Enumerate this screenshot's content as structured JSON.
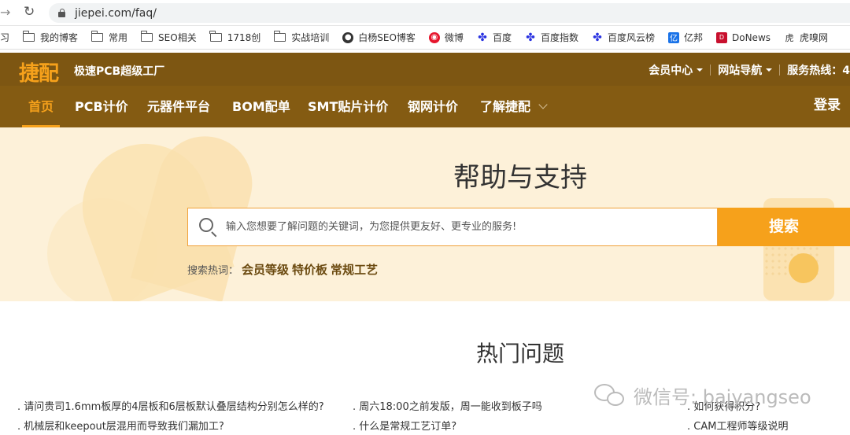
{
  "browser": {
    "url": "jiepei.com/faq/",
    "bookmarks": [
      {
        "label": "学习",
        "icon": "none"
      },
      {
        "label": "我的博客",
        "icon": "folder-icon"
      },
      {
        "label": "常用",
        "icon": "folder-icon"
      },
      {
        "label": "SEO相关",
        "icon": "folder-icon"
      },
      {
        "label": "1718创",
        "icon": "folder-icon"
      },
      {
        "label": "实战培训",
        "icon": "folder-icon"
      },
      {
        "label": "白杨SEO博客",
        "icon": "globe-icon"
      },
      {
        "label": "微博",
        "icon": "weibo-icon"
      },
      {
        "label": "百度",
        "icon": "baidu-paw-icon"
      },
      {
        "label": "百度指数",
        "icon": "baidu-paw-icon"
      },
      {
        "label": "百度风云榜",
        "icon": "baidu-paw-icon"
      },
      {
        "label": "亿邦",
        "icon": "yibang-icon"
      },
      {
        "label": "DoNews",
        "icon": "donews-icon"
      },
      {
        "label": "虎嗅网",
        "icon": "huxiu-icon"
      }
    ]
  },
  "header": {
    "logo": "捷配",
    "slogan": "极速PCB超级工厂",
    "member_center": "会员中心",
    "site_nav": "网站导航",
    "hotline": "服务热线：4"
  },
  "nav": {
    "items": [
      "首页",
      "PCB计价",
      "元器件平台",
      "BOM配单",
      "SMT贴片计价",
      "钢网计价",
      "了解捷配"
    ],
    "active": "首页",
    "login": "登录"
  },
  "hero": {
    "title": "帮助与支持",
    "search_placeholder": "输入您想要了解问题的关键词，为您提供更友好、更专业的服务!",
    "search_button": "搜索",
    "hot_label": "搜索热词：",
    "hot_keywords": [
      "会员等级",
      "特价板",
      "常规工艺"
    ]
  },
  "hot_questions": {
    "title": "热门问题",
    "items": [
      ". 请问贵司1.6mm板厚的4层板和6层板默认叠层结构分别怎么样的?",
      ". 周六18:00之前发版，周一能收到板子吗",
      ". 如何获得积分?",
      ". 机械层和keepout层混用而导致我们漏加工?",
      ". 什么是常规工艺订单?",
      ". CAM工程师等级说明"
    ]
  },
  "watermark": {
    "text": "微信号: baiyangseo"
  },
  "colors": {
    "header_bg": "#7d5612",
    "accent": "#f6a11b",
    "hero_bg": "#fdf1d9"
  }
}
